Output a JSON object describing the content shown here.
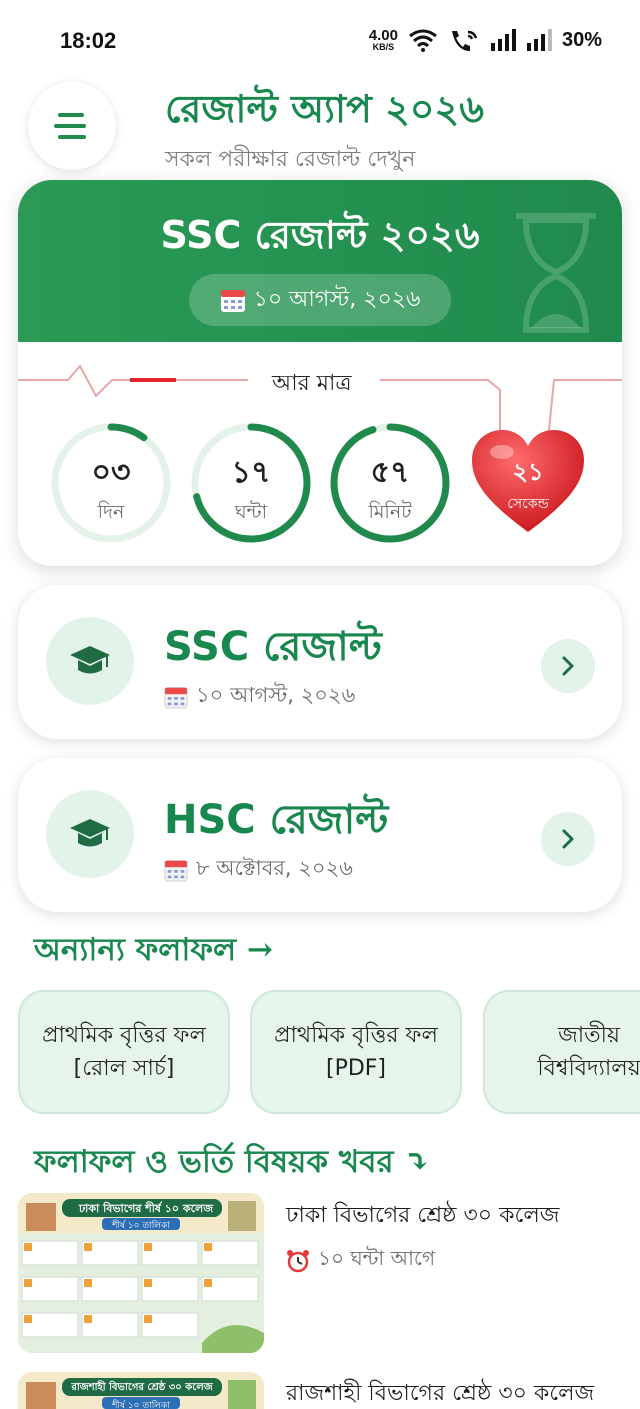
{
  "status": {
    "time": "18:02",
    "net_speed_value": "4.00",
    "net_speed_unit": "KB/S",
    "battery": "30%"
  },
  "header": {
    "title": "রেজাল্ট অ্যাপ ২০২৬",
    "subtitle": "সকল পরীক্ষার রেজাল্ট দেখুন"
  },
  "countdown": {
    "title": "SSC রেজাল্ট ২০২৬",
    "date": "১০ আগস্ট, ২০২৬",
    "remaining_label": "আর মাত্র",
    "days": "০৩",
    "days_label": "দিন",
    "hours": "১৭",
    "hours_label": "ঘন্টা",
    "minutes": "৫৭",
    "minutes_label": "মিনিট",
    "seconds": "২১",
    "seconds_label": "সেকেন্ড",
    "progress": {
      "days": 0.1,
      "hours": 0.71,
      "minutes": 0.95
    },
    "accent": "#1f8a4c",
    "heart_color": "#e3242b"
  },
  "results": [
    {
      "title": "SSC রেজাল্ট",
      "date": "১০ আগস্ট, ২০২৬"
    },
    {
      "title": "HSC রেজাল্ট",
      "date": "৮ অক্টোবর, ২০২৬"
    }
  ],
  "other_results": {
    "title": "অন্যান্য ফলাফল →",
    "chips": [
      {
        "line1": "প্রাথমিক বৃত্তির ফল",
        "line2": "[রোল সার্চ]"
      },
      {
        "line1": "প্রাথমিক বৃত্তির ফল",
        "line2": "[PDF]"
      },
      {
        "line1": "জাতীয়",
        "line2": "বিশ্ববিদ্যালয়"
      }
    ]
  },
  "news": {
    "title": "ফলাফল ও ভর্তি বিষয়ক খবর ⤵",
    "items": [
      {
        "title": "ঢাকা বিভাগের শ্রেষ্ঠ ৩০ কলেজ",
        "time": "১০ ঘন্টা আগে",
        "thumb_heading": "ঢাকা বিভাগের শীর্ষ ১০ কলেজ",
        "thumb_badge": "শীর্ষ ১০ তালিকা"
      },
      {
        "title": "রাজশাহী বিভাগের শ্রেষ্ঠ ৩০ কলেজ",
        "thumb_heading": "রাজশাহী বিভাগের শ্রেষ্ঠ ৩০ কলেজ",
        "thumb_badge": "শীর্ষ ১০ তালিকা"
      }
    ]
  }
}
